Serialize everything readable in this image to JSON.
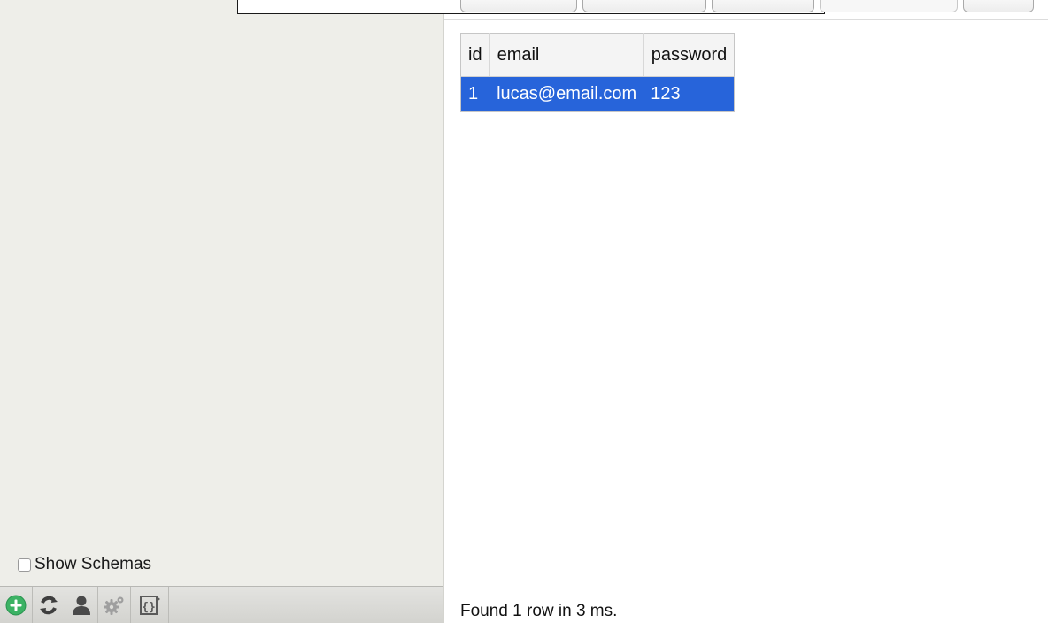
{
  "sidebar": {
    "show_schemas_label": "Show Schemas",
    "show_schemas_checked": false,
    "toolbar": [
      {
        "name": "add-icon",
        "color": "#3cb264"
      },
      {
        "name": "refresh-icon",
        "color": "#444444"
      },
      {
        "name": "user-icon",
        "color": "#4a4a4a"
      },
      {
        "name": "gear-icon",
        "color": "#9a9a9a"
      },
      {
        "name": "braces-icon",
        "color": "#5a5a5a"
      }
    ]
  },
  "results": {
    "columns": [
      "id",
      "email",
      "password"
    ],
    "rows": [
      {
        "id": "1",
        "email": "lucas@email.com",
        "password": "123",
        "selected": true
      }
    ],
    "selection_color": "#2764da"
  },
  "status": {
    "message": "Found 1 row in 3 ms."
  }
}
